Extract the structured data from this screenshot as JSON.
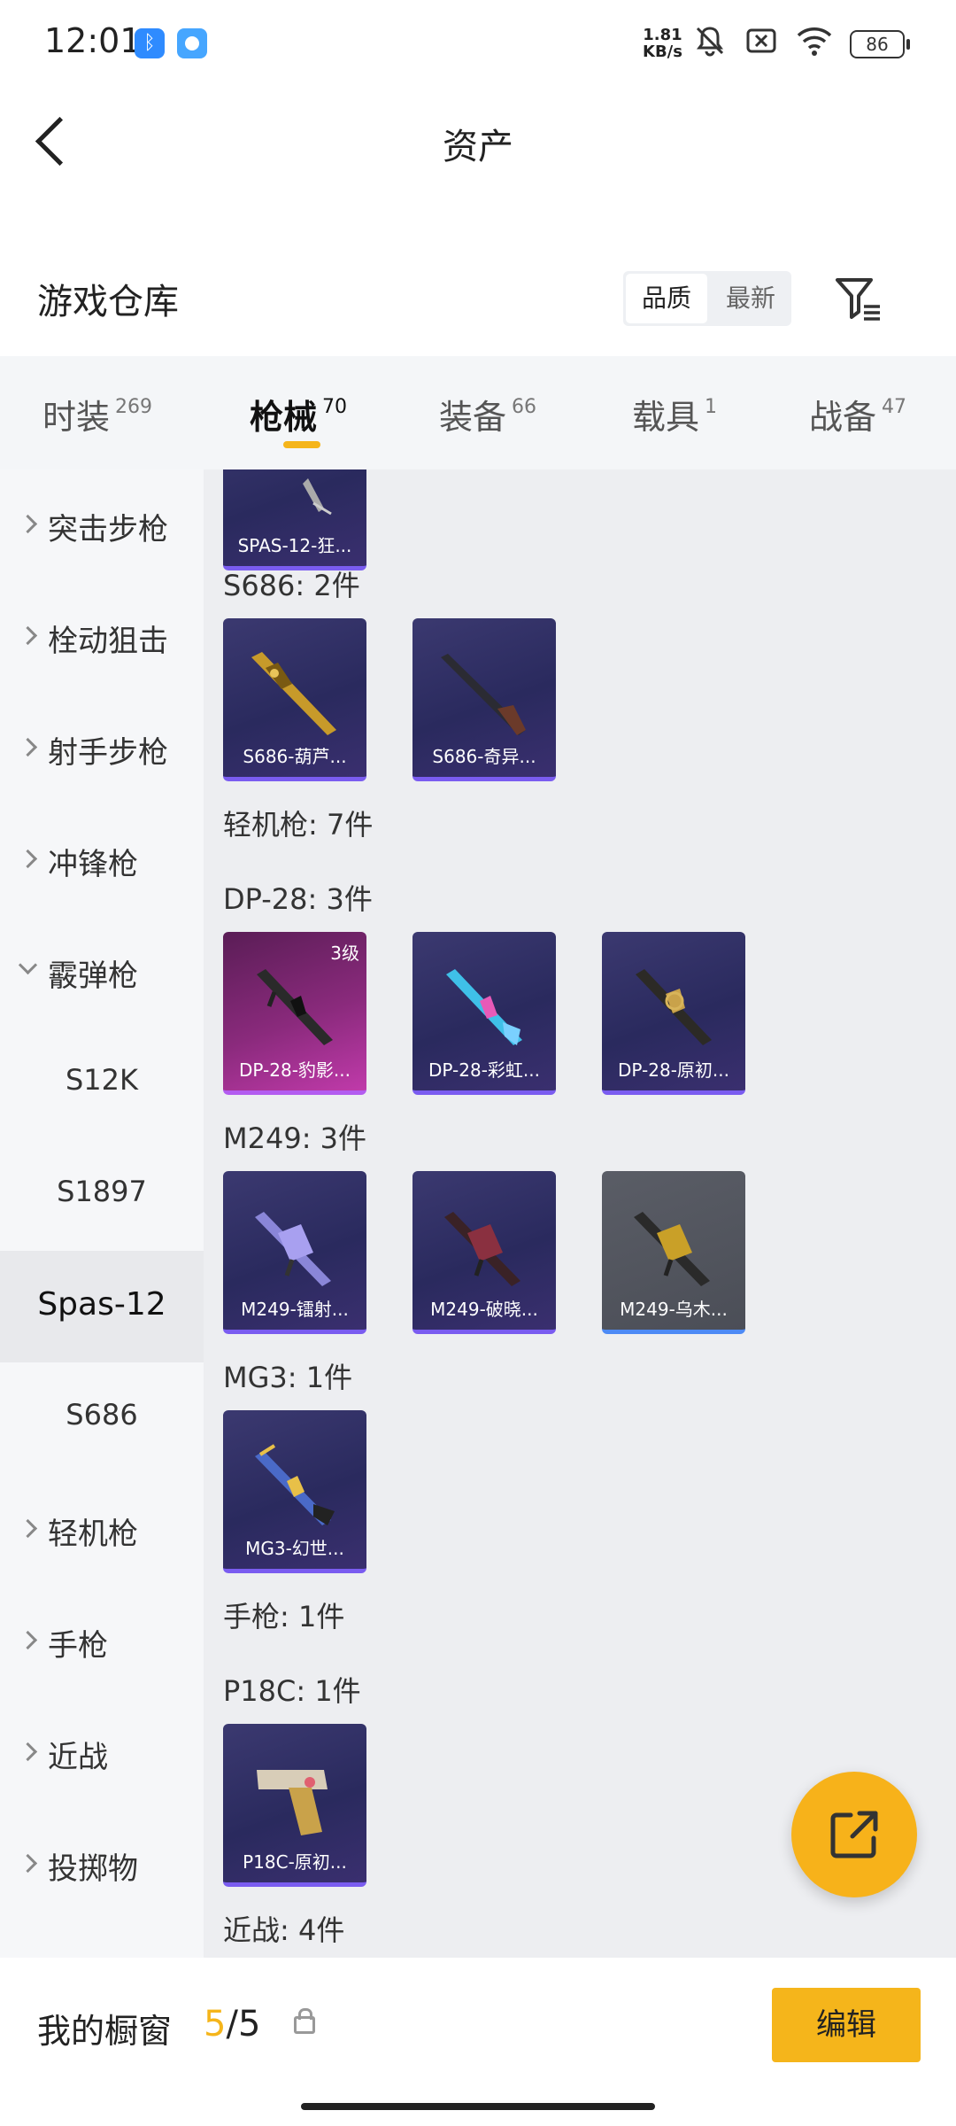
{
  "status_bar": {
    "time": "12:01",
    "net_speed_value": "1.81",
    "net_speed_unit": "KB/s",
    "battery": "86"
  },
  "header": {
    "title": "资产"
  },
  "warehouse": {
    "title": "游戏仓库",
    "sort_options": [
      "品质",
      "最新"
    ],
    "active_sort": "品质"
  },
  "tabs": [
    {
      "label": "时装",
      "count": "269"
    },
    {
      "label": "枪械",
      "count": "70",
      "active": true
    },
    {
      "label": "装备",
      "count": "66"
    },
    {
      "label": "载具",
      "count": "1"
    },
    {
      "label": "战备",
      "count": "47"
    }
  ],
  "sidebar": {
    "items": [
      {
        "label": "突击步枪",
        "type": "group"
      },
      {
        "label": "栓动狙击",
        "type": "group"
      },
      {
        "label": "射手步枪",
        "type": "group"
      },
      {
        "label": "冲锋枪",
        "type": "group"
      },
      {
        "label": "霰弹枪",
        "type": "group-expanded"
      },
      {
        "label": "S12K",
        "type": "sub"
      },
      {
        "label": "S1897",
        "type": "sub"
      },
      {
        "label": "Spas-12",
        "type": "sub-selected"
      },
      {
        "label": "S686",
        "type": "sub"
      },
      {
        "label": "轻机枪",
        "type": "group"
      },
      {
        "label": "手枪",
        "type": "group"
      },
      {
        "label": "近战",
        "type": "group"
      },
      {
        "label": "投掷物",
        "type": "group"
      }
    ]
  },
  "content": {
    "top_card": "SPAS-12-狂...",
    "sections": {
      "s686": "S686: 2件",
      "lmg": "轻机枪: 7件",
      "dp28": "DP-28: 3件",
      "m249": "M249: 3件",
      "mg3": "MG3: 1件",
      "pistol": "手枪: 1件",
      "p18c": "P18C: 1件",
      "melee": "近战: 4件"
    },
    "cards": {
      "s686_1": "S686-葫芦...",
      "s686_2": "S686-奇异...",
      "dp28_1": "DP-28-豹影...",
      "dp28_1_level": "3级",
      "dp28_2": "DP-28-彩虹...",
      "dp28_3": "DP-28-原初...",
      "m249_1": "M249-镭射...",
      "m249_2": "M249-破晓...",
      "m249_3": "M249-乌木...",
      "mg3_1": "MG3-幻世...",
      "p18c_1": "P18C-原初..."
    }
  },
  "bottom_bar": {
    "label": "我的橱窗",
    "current": "5",
    "separator": "/",
    "total": "5",
    "edit_label": "编辑"
  },
  "colors": {
    "accent": "#f5b51b",
    "card_bg": "#2a2a5e",
    "card_rarity_purple": "#7a5cf0",
    "card_rarity_pink": "#c03aaa",
    "card_rarity_blue": "#4d8af5"
  }
}
